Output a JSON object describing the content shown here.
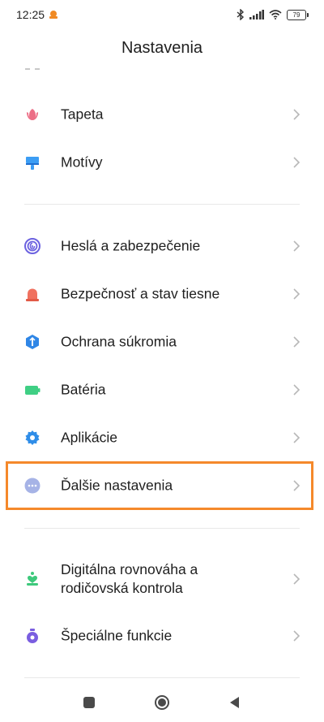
{
  "status_bar": {
    "time": "12:25",
    "battery": "79"
  },
  "header": {
    "title": "Nastavenia"
  },
  "groups": [
    {
      "items": [
        {
          "label": "Tapeta",
          "icon": "wallpaper-icon",
          "color": "#ec6e86"
        },
        {
          "label": "Motívy",
          "icon": "themes-icon",
          "color": "#3c9df4"
        }
      ]
    },
    {
      "items": [
        {
          "label": "Heslá a zabezpečenie",
          "icon": "fingerprint-icon",
          "color": "#6c62e0"
        },
        {
          "label": "Bezpečnosť a stav tiesne",
          "icon": "emergency-icon",
          "color": "#f0715f"
        },
        {
          "label": "Ochrana súkromia",
          "icon": "privacy-icon",
          "color": "#2f86e6"
        },
        {
          "label": "Batéria",
          "icon": "battery-icon",
          "color": "#3fcf84"
        },
        {
          "label": "Aplikácie",
          "icon": "gear-icon",
          "color": "#2f8de8"
        },
        {
          "label": "Ďalšie nastavenia",
          "icon": "more-icon",
          "color": "#a6b3e6",
          "highlighted": true
        }
      ]
    },
    {
      "items": [
        {
          "label": "Digitálna rovnováha a\nrodičovská kontrola",
          "icon": "wellbeing-icon",
          "color": "#3ec97c"
        },
        {
          "label": "Špeciálne funkcie",
          "icon": "special-features-icon",
          "color": "#7a5ee0"
        }
      ]
    }
  ],
  "nav_bar": {
    "buttons": [
      "recents-button",
      "home-button",
      "back-button"
    ]
  }
}
